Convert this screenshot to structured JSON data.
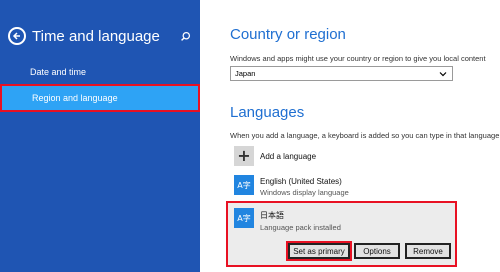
{
  "sidebar": {
    "title": "Time and language",
    "items": [
      {
        "label": "Date and time"
      },
      {
        "label": "Region and language"
      }
    ]
  },
  "country": {
    "heading": "Country or region",
    "description": "Windows and apps might use your country or region to give you local content",
    "selected": "Japan"
  },
  "languages": {
    "heading": "Languages",
    "description": "When you add a language, a keyboard is added so you can type in that language",
    "add_label": "Add a language",
    "list": [
      {
        "icon_text": "A字",
        "name": "English (United States)",
        "status": "Windows display language"
      },
      {
        "icon_text": "A字",
        "name": "日本語",
        "status": "Language pack installed"
      }
    ],
    "buttons": {
      "set_primary": "Set as primary",
      "options": "Options",
      "remove": "Remove"
    }
  },
  "icons": {
    "back": "back-arrow-icon",
    "search": "search-icon",
    "dropdown": "chevron-down-icon",
    "add": "plus-icon",
    "language": "language-icon"
  },
  "colors": {
    "sidebar_bg": "#1f55b3",
    "selected_item": "#2ea3f5",
    "accent_heading": "#1f6fd1",
    "highlight": "#e81123"
  }
}
